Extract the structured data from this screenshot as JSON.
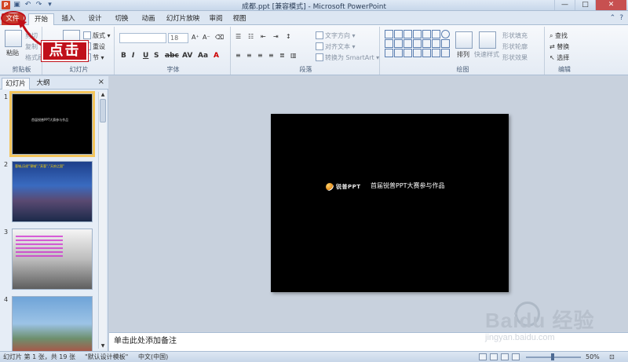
{
  "window": {
    "title": "成都.ppt [兼容模式] - Microsoft PowerPoint",
    "app_icon": "P"
  },
  "tabs": [
    "文件",
    "开始",
    "插入",
    "设计",
    "切换",
    "动画",
    "幻灯片放映",
    "审阅",
    "视图"
  ],
  "ribbon": {
    "clipboard": {
      "label": "剪贴板",
      "paste": "粘贴",
      "cut": "剪切",
      "copy": "复制",
      "painter": "格式刷"
    },
    "slides": {
      "label": "幻灯片",
      "layout": "版式",
      "reset": "重设",
      "section": "节"
    },
    "font": {
      "label": "字体",
      "font_name": "",
      "font_size": "18"
    },
    "paragraph": {
      "label": "段落",
      "text_direction": "文字方向",
      "align_text": "对齐文本",
      "smartart": "转换为 SmartArt"
    },
    "drawing": {
      "label": "绘图",
      "arrange": "排列",
      "quick_styles": "快速样式",
      "shape_fill": "形状填充",
      "shape_outline": "形状轮廓",
      "shape_effects": "形状效果"
    },
    "editing": {
      "label": "编辑",
      "find": "查找",
      "replace": "替换",
      "select": "选择"
    }
  },
  "annotation": {
    "callout_text": "点击"
  },
  "left_pane": {
    "tab_slides": "幻灯片",
    "tab_outline": "大纲",
    "close": "×",
    "thumbnails": [
      {
        "num": "1",
        "caption": "首届锐普PPT大赛参与作品"
      },
      {
        "num": "2",
        "caption": "蓉城,历经\"锦城\",\"芙蓉\",\"天府之国\""
      },
      {
        "num": "3",
        "caption": ""
      },
      {
        "num": "4",
        "caption": ""
      }
    ]
  },
  "slide": {
    "logo_text": "锐普PPT",
    "title": "首届锐普PPT大赛参与作品"
  },
  "notes": {
    "placeholder": "单击此处添加备注"
  },
  "statusbar": {
    "slide_info": "幻灯片 第 1 张，共 19 张",
    "theme": "\"默认设计模板\"",
    "language": "中文(中国)",
    "zoom": "50%"
  },
  "watermark": {
    "brand": "Baidu 经验",
    "url": "jingyan.baidu.com"
  },
  "colors": {
    "file_tab": "#c6372a",
    "callout": "#c0101a",
    "accent": "#3b5a86"
  }
}
